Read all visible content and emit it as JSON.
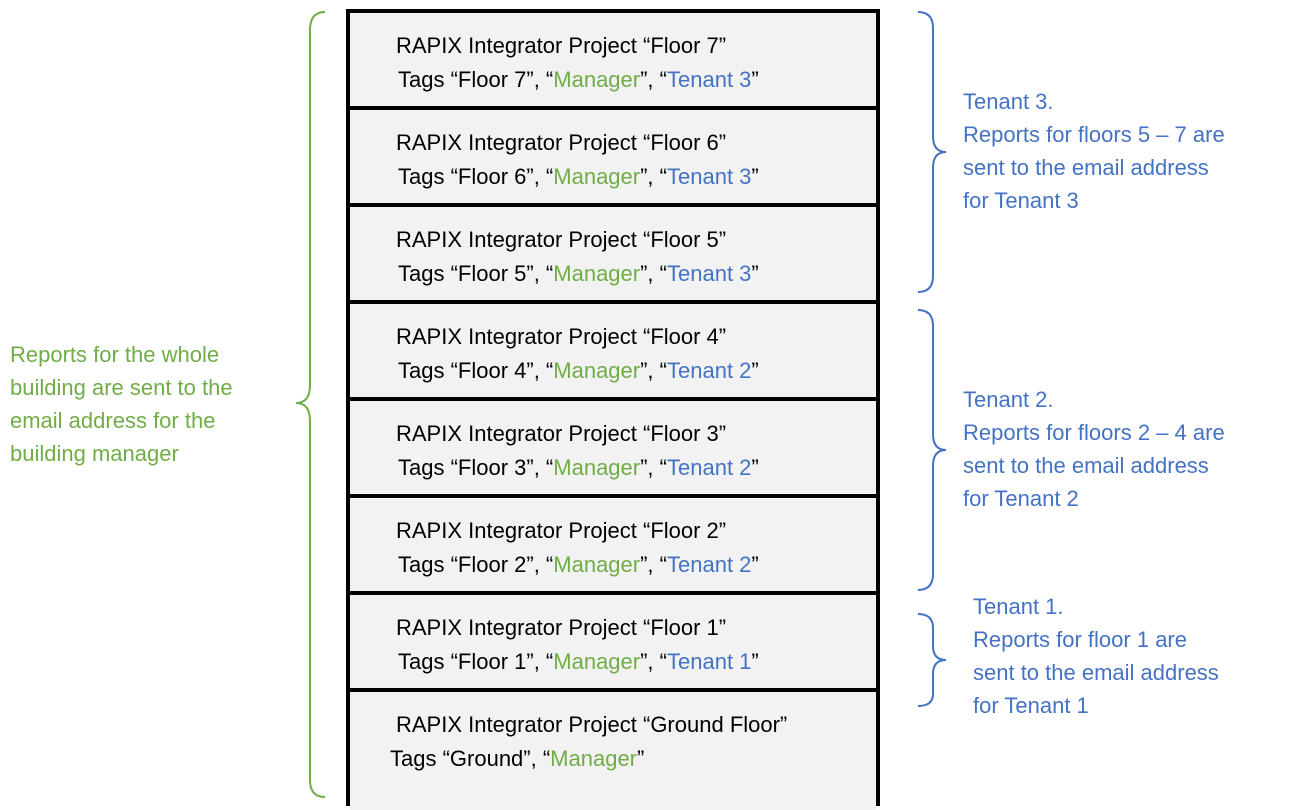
{
  "floors": [
    {
      "title": "RAPIX Integrator Project “Floor 7”",
      "tag_floor": "Tags “Floor 7”, “",
      "tag_manager": "Manager",
      "tag_mid": "”, “",
      "tag_tenant": "Tenant 3",
      "tag_end": "”"
    },
    {
      "title": "RAPIX Integrator Project “Floor 6”",
      "tag_floor": "Tags “Floor 6”, “",
      "tag_manager": "Manager",
      "tag_mid": "”, “",
      "tag_tenant": "Tenant 3",
      "tag_end": "”"
    },
    {
      "title": "RAPIX Integrator Project “Floor 5”",
      "tag_floor": "Tags “Floor 5”, “",
      "tag_manager": "Manager",
      "tag_mid": "”, “",
      "tag_tenant": "Tenant 3",
      "tag_end": "”"
    },
    {
      "title": "RAPIX Integrator Project “Floor 4”",
      "tag_floor": "Tags “Floor 4”, “",
      "tag_manager": "Manager",
      "tag_mid": "”, “",
      "tag_tenant": "Tenant 2",
      "tag_end": "”"
    },
    {
      "title": "RAPIX Integrator Project “Floor 3”",
      "tag_floor": "Tags “Floor 3”, “",
      "tag_manager": "Manager",
      "tag_mid": "”, “",
      "tag_tenant": "Tenant 2",
      "tag_end": "”"
    },
    {
      "title": "RAPIX Integrator Project “Floor 2”",
      "tag_floor": "Tags “Floor 2”, “",
      "tag_manager": "Manager",
      "tag_mid": "”, “",
      "tag_tenant": "Tenant 2",
      "tag_end": "”"
    },
    {
      "title": "RAPIX Integrator Project “Floor 1”",
      "tag_floor": "Tags “Floor 1”, “",
      "tag_manager": "Manager",
      "tag_mid": "”, “",
      "tag_tenant": "Tenant 1",
      "tag_end": "”"
    },
    {
      "title": "RAPIX Integrator Project “Ground Floor”",
      "tag_floor": "Tags “Ground”, “",
      "tag_manager": "Manager",
      "tag_mid": "”",
      "tag_tenant": "",
      "tag_end": ""
    }
  ],
  "notes": {
    "manager": [
      "Reports for the whole",
      "building are sent to the",
      "email address for the",
      "building manager"
    ],
    "tenant3": [
      "Tenant 3.",
      "Reports for floors 5 – 7 are",
      "sent to the email address",
      "for Tenant 3"
    ],
    "tenant2": [
      "Tenant 2.",
      "Reports for floors 2 – 4 are",
      "sent to the email address",
      "for Tenant 2"
    ],
    "tenant1": [
      "Tenant 1.",
      "Reports for floor 1 are",
      "sent to the email address",
      "for Tenant 1"
    ]
  },
  "colors": {
    "manager": "#70ad47",
    "tenant": "#4472c4",
    "floor_bg": "#f2f2f2",
    "border": "#000000"
  }
}
